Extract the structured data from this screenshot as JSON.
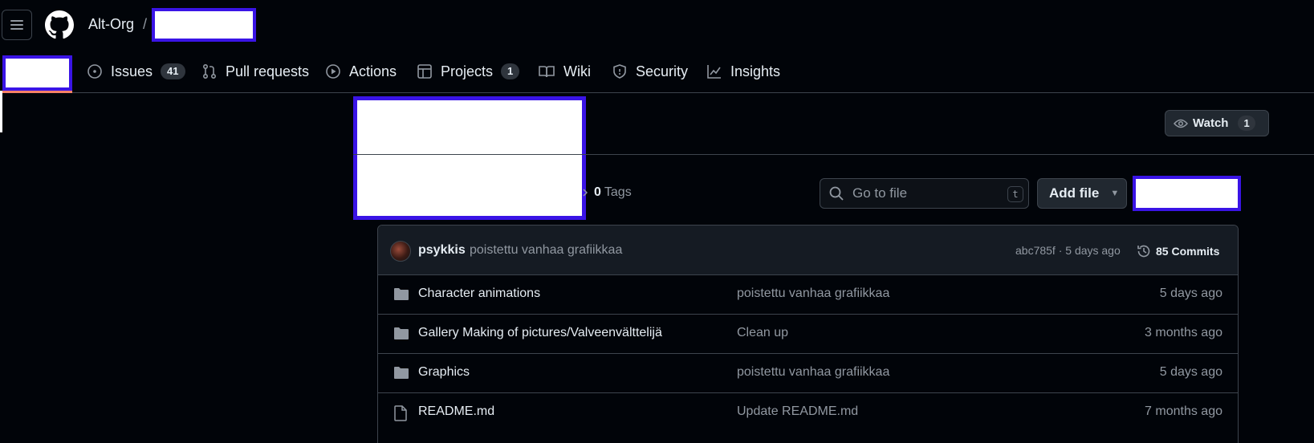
{
  "header": {
    "org": "Alt-Org",
    "separator": "/"
  },
  "nav": {
    "tabs": [
      {
        "label": "Issues",
        "count": "41",
        "icon": "issue-icon"
      },
      {
        "label": "Pull requests",
        "icon": "pull-request-icon"
      },
      {
        "label": "Actions",
        "icon": "play-icon"
      },
      {
        "label": "Projects",
        "count": "1",
        "icon": "table-icon"
      },
      {
        "label": "Wiki",
        "icon": "book-icon"
      },
      {
        "label": "Security",
        "icon": "shield-icon"
      },
      {
        "label": "Insights",
        "icon": "graph-icon"
      }
    ]
  },
  "repo_actions": {
    "watch_label": "Watch",
    "watch_count": "1"
  },
  "toolbar": {
    "tags_count": "0",
    "tags_label": "Tags",
    "search_placeholder": "Go to file",
    "search_shortcut": "t",
    "add_file_label": "Add file"
  },
  "latest_commit": {
    "author": "psykkis",
    "message": "poistettu vanhaa grafiikkaa",
    "meta": "abc785f · 5 days ago",
    "commits_label": "85 Commits"
  },
  "files": [
    {
      "type": "folder",
      "name": "Character animations",
      "message": "poistettu vanhaa grafiikkaa",
      "date": "5 days ago"
    },
    {
      "type": "folder",
      "name": "Gallery Making of pictures/Valveenvälttelijä",
      "message": "Clean up",
      "date": "3 months ago"
    },
    {
      "type": "folder",
      "name": "Graphics",
      "message": "poistettu vanhaa grafiikkaa",
      "date": "5 days ago"
    },
    {
      "type": "file",
      "name": "README.md",
      "message": "Update README.md",
      "date": "7 months ago"
    }
  ],
  "colors": {
    "background": "#010409",
    "border": "#3d444d",
    "active_tab_underline": "#f78166",
    "redaction_border": "#3a14e6"
  }
}
